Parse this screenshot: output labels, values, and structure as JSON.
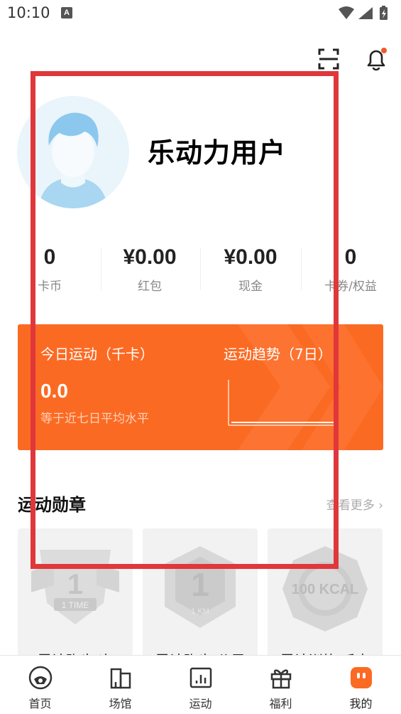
{
  "status_bar": {
    "time": "10:10",
    "indicator": "A",
    "icons": [
      "wifi-icon",
      "signal-icon",
      "battery-icon"
    ]
  },
  "top_actions": [
    "scan-icon",
    "bell-icon",
    "settings-sliders-icon"
  ],
  "profile": {
    "username": "乐动力用户",
    "avatar": "default-avatar"
  },
  "stats": [
    {
      "value": "0",
      "label": "卡币"
    },
    {
      "value": "¥0.00",
      "label": "红包"
    },
    {
      "value": "¥0.00",
      "label": "现金"
    },
    {
      "value": "0",
      "label": "卡券/权益"
    }
  ],
  "sport_card": {
    "today_title": "今日运动（千卡）",
    "trend_title": "运动趋势（7日）",
    "value": "0.0",
    "subtitle": "等于近七日平均水平"
  },
  "medals": {
    "title": "运动勋章",
    "see_more": "查看更多",
    "items": [
      {
        "label": "累计跑步/次",
        "badge_text": "1 TIME"
      },
      {
        "label": "累计跑步/公里",
        "badge_text": "1 KM"
      },
      {
        "label": "累计训练/千卡",
        "badge_text": "100 KCAL"
      }
    ]
  },
  "bottom_nav": {
    "items": [
      {
        "label": "首页",
        "icon": "home-icon"
      },
      {
        "label": "场馆",
        "icon": "venue-icon"
      },
      {
        "label": "运动",
        "icon": "sport-chart-icon"
      },
      {
        "label": "福利",
        "icon": "gift-icon"
      },
      {
        "label": "我的",
        "icon": "profile-icon"
      }
    ],
    "active_index": 4
  },
  "colors": {
    "accent": "#fb6a23",
    "annotation": "#e0373b",
    "notification_dot": "#f05a28"
  }
}
